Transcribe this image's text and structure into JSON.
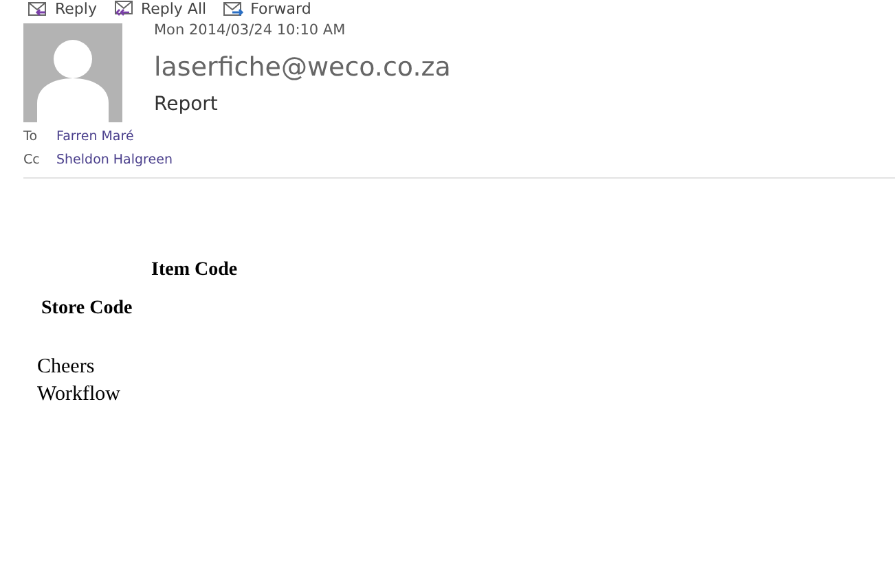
{
  "toolbar": [
    {
      "label": "Reply",
      "kind": "reply"
    },
    {
      "label": "Reply All",
      "kind": "reply-all"
    },
    {
      "label": "Forward",
      "kind": "forward"
    }
  ],
  "header": {
    "date": "Mon 2014/03/24 10:10 AM",
    "sender": "laserfiche@weco.co.za",
    "subject": "Report",
    "recipients": [
      {
        "label": "To",
        "name": "Farren Maré"
      },
      {
        "label": "Cc",
        "name": "Sheldon Halgreen"
      }
    ]
  },
  "body": {
    "headings": [
      {
        "text": "Item Code",
        "kind": "indented"
      },
      {
        "text": "Store Code",
        "kind": "plain"
      }
    ],
    "closing": [
      "Cheers",
      "Workflow"
    ]
  }
}
